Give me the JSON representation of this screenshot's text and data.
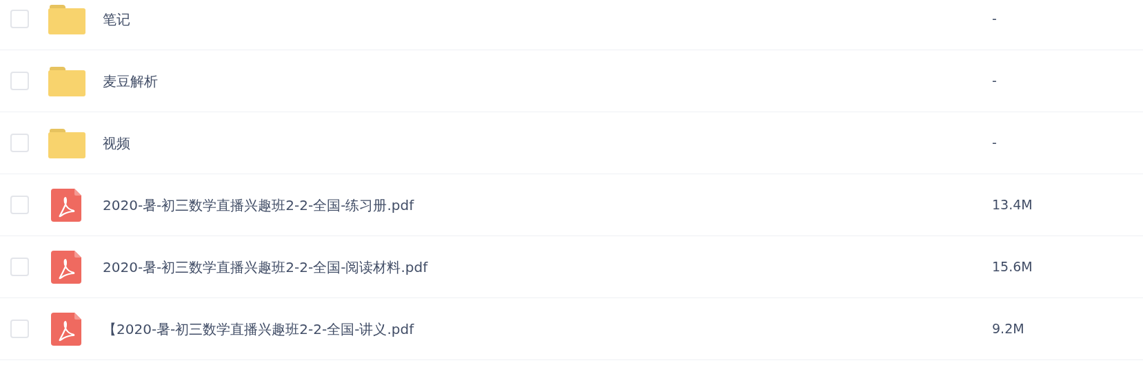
{
  "files": [
    {
      "kind": "folder",
      "name": "笔记",
      "size": "-",
      "checked": false
    },
    {
      "kind": "folder",
      "name": "麦豆解析",
      "size": "-",
      "checked": false
    },
    {
      "kind": "folder",
      "name": "视频",
      "size": "-",
      "checked": false
    },
    {
      "kind": "pdf",
      "name": "2020-暑-初三数学直播兴趣班2-2-全国-练习册.pdf",
      "size": "13.4M",
      "checked": false
    },
    {
      "kind": "pdf",
      "name": "2020-暑-初三数学直播兴趣班2-2-全国-阅读材料.pdf",
      "size": "15.6M",
      "checked": false
    },
    {
      "kind": "pdf",
      "name": "【2020-暑-初三数学直播兴趣班2-2-全国-讲义.pdf",
      "size": "9.2M",
      "checked": false
    }
  ]
}
